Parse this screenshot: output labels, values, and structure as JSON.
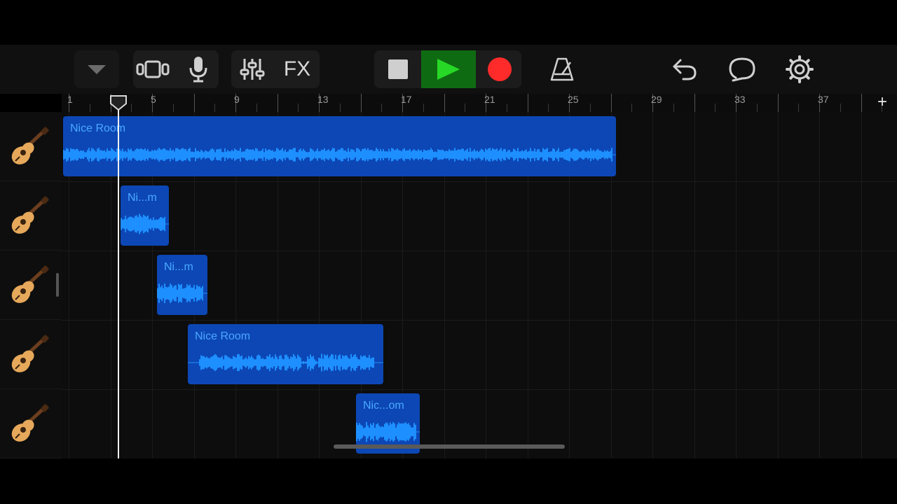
{
  "toolbar": {
    "fx_label": "FX",
    "colors": {
      "play_bg": "#0f6b12",
      "play": "#27d827",
      "record": "#ff2a2a",
      "stop": "#cfcfcf"
    },
    "icons": [
      "dropdown-icon",
      "tracks-view-icon",
      "microphone-icon",
      "mixer-sliders-icon",
      "stop-icon",
      "play-icon",
      "record-icon",
      "metronome-icon",
      "undo-icon",
      "loop-icon",
      "settings-icon"
    ]
  },
  "ruler": {
    "bar_labels": [
      "1",
      "5",
      "9",
      "13",
      "17",
      "21",
      "25",
      "29",
      "33",
      "37"
    ],
    "add_label": "+"
  },
  "tracks": [
    {
      "instrument": "acoustic-guitar-icon"
    },
    {
      "instrument": "acoustic-guitar-icon"
    },
    {
      "instrument": "acoustic-guitar-icon"
    },
    {
      "instrument": "acoustic-guitar-icon"
    },
    {
      "instrument": "acoustic-guitar-icon"
    }
  ],
  "regions": [
    {
      "label": "Nice Room"
    },
    {
      "label": "Ni...m"
    },
    {
      "label": "Ni...m"
    },
    {
      "label": "Nice Room"
    },
    {
      "label": "Nic...om"
    }
  ],
  "colors": {
    "region_fill": "#0c47b5",
    "waveform": "#1e8fff",
    "region_text": "#4aa8ff"
  }
}
